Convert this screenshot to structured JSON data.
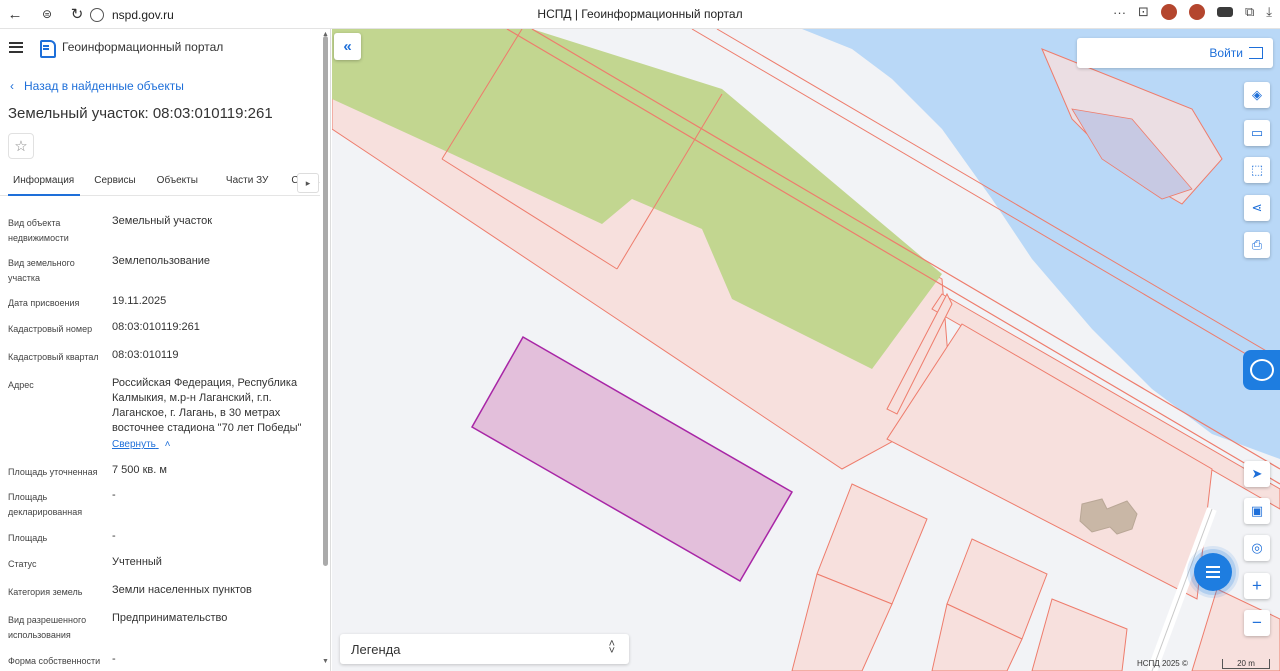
{
  "browser": {
    "url": "nspd.gov.ru",
    "tab_title": "НСПД | Геоинформационный портал"
  },
  "sidebar": {
    "portal_title": "Геоинформационный портал",
    "back_link": "Назад в найденные объекты",
    "page_title": "Земельный участок: 08:03:010119:261",
    "tabs": [
      {
        "label": "Информация"
      },
      {
        "label": "Сервисы"
      },
      {
        "label": "Объекты"
      },
      {
        "label": "Части ЗУ"
      },
      {
        "label": "Соста"
      }
    ],
    "props": [
      {
        "label": "Вид объекта недвижимости",
        "value": "Земельный участок"
      },
      {
        "label": "Вид земельного участка",
        "value": "Землепользование"
      },
      {
        "label": "Дата присвоения",
        "value": "19.11.2025"
      },
      {
        "label": "Кадастровый номер",
        "value": "08:03:010119:261"
      },
      {
        "label": "Кадастровый квартал",
        "value": "08:03:010119"
      },
      {
        "label": "Адрес",
        "value": "Российская Федерация, Республика Калмыкия, м.р-н Лаганский, г.п. Лаганское, г. Лагань, в 30 метрах восточнее стадиона \"70 лет Победы\""
      },
      {
        "label": "Площадь уточненная",
        "value": "7 500 кв. м"
      },
      {
        "label": "Площадь декларированная",
        "value": "-"
      },
      {
        "label": "Площадь",
        "value": "-"
      },
      {
        "label": "Статус",
        "value": "Учтенный"
      },
      {
        "label": "Категория земель",
        "value": "Земли населенных пунктов"
      },
      {
        "label": "Вид разрешенного использования",
        "value": "Предпринимательство"
      },
      {
        "label": "Форма собственности",
        "value": "-"
      }
    ],
    "collapse_link": "Свернуть"
  },
  "map": {
    "login_label": "Войти",
    "legend_label": "Легенда",
    "copyright": "НСПД 2025 ©",
    "scale_label": "20 m",
    "colors": {
      "water": "#b9d8f7",
      "green": "#c2d690",
      "parcel_fill": "#f7e0dd",
      "parcel_stroke": "#ee7c6c",
      "selected_fill": "#e3bfdb",
      "selected_stroke": "#a826a6",
      "accent": "#1e6fd9"
    }
  }
}
